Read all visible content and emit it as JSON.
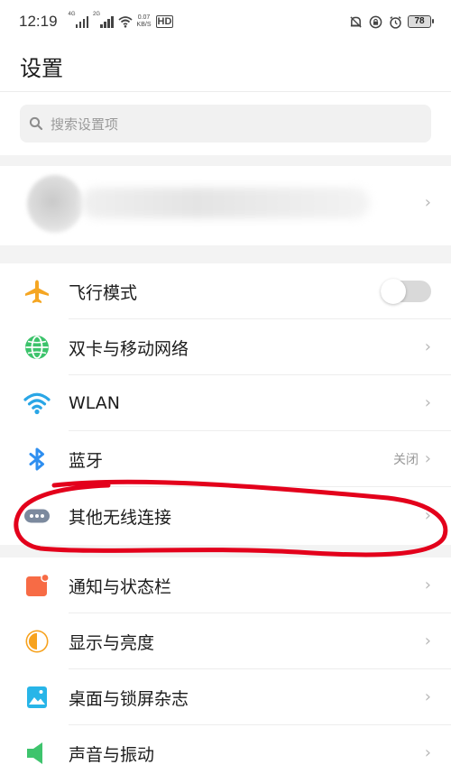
{
  "status_bar": {
    "time": "12:19",
    "sim1_tag": "4G",
    "sim2_tag": "2G",
    "speed_value": "0.07",
    "speed_unit": "KB/S",
    "hd_label": "HD",
    "battery": "78",
    "icons": [
      "signal-icon",
      "signal-icon",
      "wifi-icon",
      "hd-icon",
      "alarm-bell-icon",
      "screen-lock-icon",
      "clock-icon",
      "battery-icon"
    ]
  },
  "header": {
    "title": "设置"
  },
  "search": {
    "placeholder": "搜索设置项",
    "icon": "search-icon"
  },
  "account": {
    "chevron": "›"
  },
  "settings": {
    "items": [
      {
        "label": "飞行模式",
        "icon": "airplane-icon",
        "color": "#f5a623",
        "control": "toggle",
        "toggle_on": false
      },
      {
        "label": "双卡与移动网络",
        "icon": "globe-icon",
        "color": "#3cc36b",
        "chevron": "›"
      },
      {
        "label": "WLAN",
        "icon": "wifi-icon",
        "color": "#2aa6e6",
        "chevron": "›"
      },
      {
        "label": "蓝牙",
        "icon": "bluetooth-icon",
        "color": "#2f8ff0",
        "value": "关闭",
        "chevron": "›"
      },
      {
        "label": "其他无线连接",
        "icon": "more-dots-icon",
        "color": "#7c8a9e",
        "chevron": "›"
      },
      {
        "label": "通知与状态栏",
        "icon": "notification-icon",
        "color": "#f76b45",
        "chevron": "›"
      },
      {
        "label": "显示与亮度",
        "icon": "brightness-icon",
        "color": "#f7a21d",
        "chevron": "›"
      },
      {
        "label": "桌面与锁屏杂志",
        "icon": "wallpaper-icon",
        "color": "#28b5e8",
        "chevron": "›"
      },
      {
        "label": "声音与振动",
        "icon": "speaker-icon",
        "color": "#3ec46d",
        "chevron": "›"
      }
    ]
  },
  "annotation": {
    "color": "#e3001b",
    "target": "其他无线连接"
  }
}
